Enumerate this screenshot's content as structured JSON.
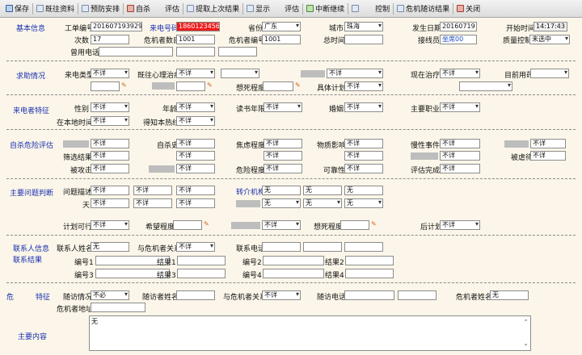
{
  "toolbar": [
    {
      "name": "save",
      "label": "保存",
      "icon": "save-icon",
      "color": "blu"
    },
    {
      "name": "past-info",
      "label": "既往资料",
      "icon": "folder-icon",
      "color": ""
    },
    {
      "name": "prevention",
      "label": "预防安排",
      "icon": "calendar-icon",
      "color": ""
    },
    {
      "name": "suicide-eval",
      "label": "自杀　　评估",
      "icon": "checklist-icon",
      "color": "red"
    },
    {
      "name": "fetch-last",
      "label": "提取上次结果",
      "icon": "fetch-icon",
      "color": ""
    },
    {
      "name": "show-eval",
      "label": "显示　　评估",
      "icon": "eye-icon",
      "color": ""
    },
    {
      "name": "interrupt",
      "label": "中断继续",
      "icon": "pause-icon",
      "color": "grn"
    },
    {
      "name": "control",
      "label": "　　控制",
      "icon": "control-icon",
      "color": ""
    },
    {
      "name": "crisis-result",
      "label": "危机随访结果",
      "icon": "report-icon",
      "color": ""
    },
    {
      "name": "close",
      "label": "关闭",
      "icon": "close-icon",
      "color": "red"
    }
  ],
  "sections": {
    "basic": "基本信息",
    "help": "求助情况",
    "caller": "来电者特征",
    "suicide": "自杀危险评估",
    "problem": "主要问题判断",
    "contact_info": "联系人信息",
    "contact_result": "联系结果",
    "followup": "危　　　特征",
    "main_content": "主要内容"
  },
  "labels": {
    "work_no": "工单编号",
    "caller_no": "来电号码",
    "province": "省份",
    "city": "城市",
    "date": "发生日期",
    "start_time": "开始时间",
    "times": "次数",
    "crisis_count": "危机者数目",
    "crisis_no": "危机者编号",
    "total_time": "总时间",
    "operator": "接线员",
    "qc": "质量控制",
    "phone_used": "曾用电话",
    "call_type": "来电类型",
    "past_psy": "既往心理治疗",
    "now_treat": "现在治疗",
    "current_drug": "目前用药",
    "death_level": "想死程度",
    "plan": "具体计划",
    "gender": "性别",
    "age": "年龄",
    "edu": "读书年限",
    "marriage": "婚姻",
    "job": "主要职业",
    "local_time": "在本地时间",
    "hotline": "得知本热线",
    "suicide_hist": "自杀史",
    "despair": "焦虑程度",
    "material": "物质影响",
    "life_event": "慢性事件",
    "screen_result": "筛选结果",
    "attacked": "被攻击",
    "danger_level": "危险程度",
    "trust": "可靠性",
    "eval_done": "评估完成",
    "abused": "被虐待",
    "problem_desc": "问题描述",
    "days": "天",
    "referral": "转介机构",
    "plan_ok": "计划可行",
    "hope": "希望程度",
    "death_level2": "想死程度",
    "post_plan": "后计划",
    "contact_name": "联系人姓名",
    "relation": "与危机者关系",
    "contact_phone": "联系电话",
    "no1": "编号1",
    "no2": "编号2",
    "no3": "编号3",
    "no4": "编号4",
    "res1": "结果1",
    "res2": "结果2",
    "res3": "结果3",
    "res4": "结果4",
    "visit_status": "随访情况",
    "visitor_name": "随访者姓名",
    "visit_relation": "与危机者关系",
    "visit_phone": "随访电话",
    "crisis_name": "危机者姓名",
    "crisis_addr": "危机者地址"
  },
  "values": {
    "work_no": "201607193929",
    "caller_no": "1860123456",
    "province": "广东",
    "city": "珠海",
    "date": "20160719",
    "start_time": "14:17:43",
    "times": "17",
    "crisis_count": "1001",
    "crisis_no": "1001",
    "operator": "坐席00",
    "qc": "未选中",
    "unknown": "不详",
    "none": "无",
    "not_needed": "不必",
    "main_content": "无"
  }
}
